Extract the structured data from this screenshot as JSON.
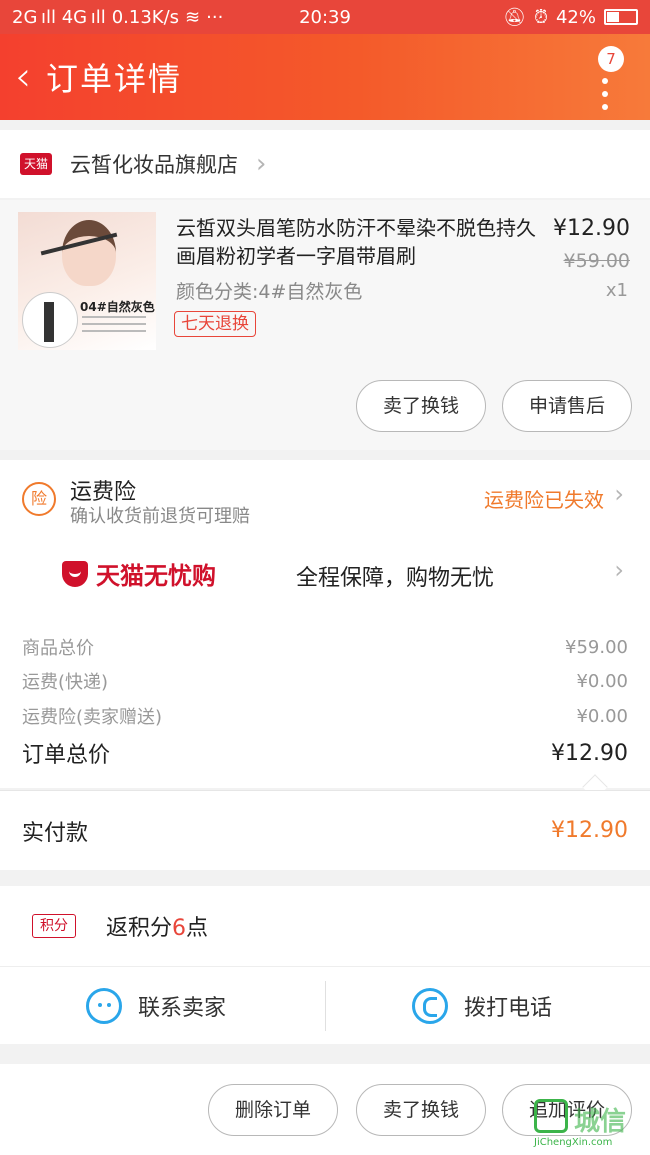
{
  "status_bar": {
    "signal": "2G ıll 4G ıll",
    "speed": "0.13K/s",
    "dots": "···",
    "time": "20:39",
    "battery_text": "42%",
    "battery_level": 0.42
  },
  "header": {
    "title": "订单详情",
    "badge_count": "7"
  },
  "store": {
    "logo_text": "天猫",
    "name": "云皙化妆品旗舰店"
  },
  "product": {
    "image_label": "04#自然灰色",
    "title": "云皙双头眉笔防水防汗不晕染不脱色持久画眉粉初学者一字眉带眉刷",
    "spec": "颜色分类:4#自然灰色",
    "tag": "七天退换",
    "price": "¥12.90",
    "original_price": "¥59.00",
    "quantity": "x1",
    "buttons": [
      "卖了换钱",
      "申请售后"
    ]
  },
  "insurance": {
    "icon_text": "险",
    "title": "运费险",
    "subtitle": "确认收货前退货可理赔",
    "status": "运费险已失效",
    "wuyou_brand": "天猫无忧购",
    "wuyou_slogan": "全程保障，购物无忧"
  },
  "costs": [
    {
      "label": "商品总价",
      "value": "¥59.00"
    },
    {
      "label": "运费(快递)",
      "value": "¥0.00"
    },
    {
      "label": "运费险(卖家赠送)",
      "value": "¥0.00"
    }
  ],
  "order_total": {
    "label": "订单总价",
    "value": "¥12.90"
  },
  "paid": {
    "label": "实付款",
    "value": "¥12.90"
  },
  "points": {
    "tag": "积分",
    "prefix": "返积分",
    "count": "6",
    "suffix": "点"
  },
  "contact": {
    "seller": "联系卖家",
    "phone": "拨打电话"
  },
  "bottom_bar": {
    "buttons": [
      "删除订单",
      "卖了换钱",
      "追加评价"
    ]
  },
  "watermark": {
    "text": "城信",
    "sub": "JiChengXin.com"
  },
  "colors": {
    "brand_red": "#e8463a",
    "tmall_red": "#d0112b",
    "orange": "#f07a2c",
    "blue": "#2aa6ea"
  }
}
